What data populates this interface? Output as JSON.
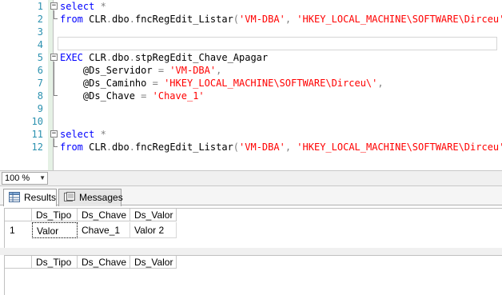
{
  "editor": {
    "line_numbers": [
      "1",
      "2",
      "3",
      "4",
      "5",
      "6",
      "7",
      "8",
      "9",
      "10",
      "11",
      "12"
    ],
    "lines": [
      [
        {
          "t": "kw",
          "v": "select"
        },
        {
          "t": "plain",
          "v": " "
        },
        {
          "t": "op",
          "v": "*"
        }
      ],
      [
        {
          "t": "kw",
          "v": "from"
        },
        {
          "t": "plain",
          "v": " CLR"
        },
        {
          "t": "op",
          "v": "."
        },
        {
          "t": "plain",
          "v": "dbo"
        },
        {
          "t": "op",
          "v": "."
        },
        {
          "t": "plain",
          "v": "fncRegEdit_Listar"
        },
        {
          "t": "op",
          "v": "("
        },
        {
          "t": "str",
          "v": "'VM-DBA'"
        },
        {
          "t": "op",
          "v": ","
        },
        {
          "t": "plain",
          "v": " "
        },
        {
          "t": "str",
          "v": "'HKEY_LOCAL_MACHINE\\SOFTWARE\\Dirceu'"
        },
        {
          "t": "op",
          "v": ")"
        }
      ],
      [],
      [],
      [
        {
          "t": "kw",
          "v": "EXEC"
        },
        {
          "t": "plain",
          "v": " CLR"
        },
        {
          "t": "op",
          "v": "."
        },
        {
          "t": "plain",
          "v": "dbo"
        },
        {
          "t": "op",
          "v": "."
        },
        {
          "t": "plain",
          "v": "stpRegEdit_Chave_Apagar"
        }
      ],
      [
        {
          "t": "plain",
          "v": "    @Ds_Servidor "
        },
        {
          "t": "op",
          "v": "="
        },
        {
          "t": "plain",
          "v": " "
        },
        {
          "t": "str",
          "v": "'VM-DBA'"
        },
        {
          "t": "op",
          "v": ","
        }
      ],
      [
        {
          "t": "plain",
          "v": "    @Ds_Caminho "
        },
        {
          "t": "op",
          "v": "="
        },
        {
          "t": "plain",
          "v": " "
        },
        {
          "t": "str",
          "v": "'HKEY_LOCAL_MACHINE\\SOFTWARE\\Dirceu\\'"
        },
        {
          "t": "op",
          "v": ","
        }
      ],
      [
        {
          "t": "plain",
          "v": "    @Ds_Chave "
        },
        {
          "t": "op",
          "v": "="
        },
        {
          "t": "plain",
          "v": " "
        },
        {
          "t": "str",
          "v": "'Chave_1'"
        }
      ],
      [],
      [],
      [
        {
          "t": "kw",
          "v": "select"
        },
        {
          "t": "plain",
          "v": " "
        },
        {
          "t": "op",
          "v": "*"
        }
      ],
      [
        {
          "t": "kw",
          "v": "from"
        },
        {
          "t": "plain",
          "v": " CLR"
        },
        {
          "t": "op",
          "v": "."
        },
        {
          "t": "plain",
          "v": "dbo"
        },
        {
          "t": "op",
          "v": "."
        },
        {
          "t": "plain",
          "v": "fncRegEdit_Listar"
        },
        {
          "t": "op",
          "v": "("
        },
        {
          "t": "str",
          "v": "'VM-DBA'"
        },
        {
          "t": "op",
          "v": ","
        },
        {
          "t": "plain",
          "v": " "
        },
        {
          "t": "str",
          "v": "'HKEY_LOCAL_MACHINE\\SOFTWARE\\Dirceu'"
        },
        {
          "t": "op",
          "v": ")"
        }
      ]
    ]
  },
  "zoom": {
    "value": "100 %"
  },
  "tabs": {
    "results": "Results",
    "messages": "Messages"
  },
  "grid1": {
    "columns": [
      "Ds_Tipo",
      "Ds_Chave",
      "Ds_Valor"
    ],
    "rows": [
      {
        "num": "1",
        "cells": [
          "Valor",
          "Chave_1",
          "Valor 2"
        ]
      }
    ]
  },
  "grid2": {
    "columns": [
      "Ds_Tipo",
      "Ds_Chave",
      "Ds_Valor"
    ]
  },
  "colors": {
    "keyword": "#0000ff",
    "string": "#ff0000",
    "operator": "#808080",
    "line_number": "#2b91af"
  }
}
